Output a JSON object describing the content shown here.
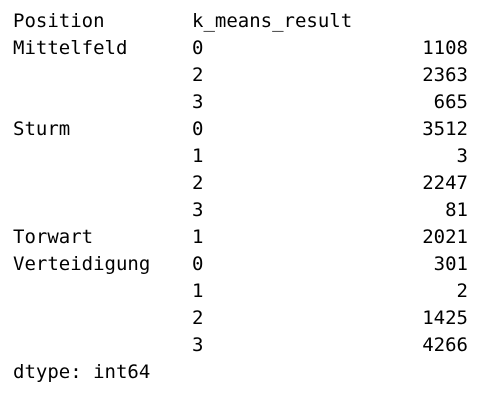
{
  "output": {
    "header": {
      "index_name_1": "Position",
      "index_name_2": "k_means_result"
    },
    "rows": [
      {
        "position": "Mittelfeld",
        "cluster": "0",
        "count": "1108"
      },
      {
        "position": "",
        "cluster": "2",
        "count": "2363"
      },
      {
        "position": "",
        "cluster": "3",
        "count": "665"
      },
      {
        "position": "Sturm",
        "cluster": "0",
        "count": "3512"
      },
      {
        "position": "",
        "cluster": "1",
        "count": "3"
      },
      {
        "position": "",
        "cluster": "2",
        "count": "2247"
      },
      {
        "position": "",
        "cluster": "3",
        "count": "81"
      },
      {
        "position": "Torwart",
        "cluster": "1",
        "count": "2021"
      },
      {
        "position": "Verteidigung",
        "cluster": "0",
        "count": "301"
      },
      {
        "position": "",
        "cluster": "1",
        "count": "2"
      },
      {
        "position": "",
        "cluster": "2",
        "count": "1425"
      },
      {
        "position": "",
        "cluster": "3",
        "count": "4266"
      }
    ],
    "dtype": "dtype: int64"
  }
}
